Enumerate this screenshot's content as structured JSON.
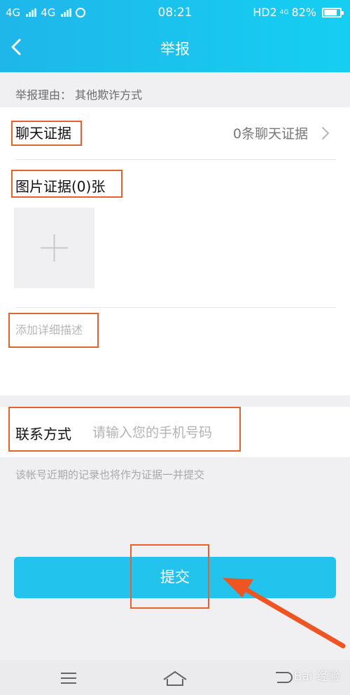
{
  "status_bar": {
    "network_left_1": "4G",
    "network_left_2": "4G",
    "time": "08:21",
    "hd_label": "HD2",
    "network_right": "4G",
    "battery_percent": "82%",
    "battery_level": 0.82
  },
  "header": {
    "title": "举报",
    "back_icon": "chevron-left-icon"
  },
  "reason": {
    "text": "举报理由：  其他欺诈方式"
  },
  "chat_evidence": {
    "label": "聊天证据",
    "value": "0条聊天证据",
    "chevron_icon": "chevron-right-icon"
  },
  "picture_evidence": {
    "label": "图片证据(0)张",
    "add_icon": "plus-icon"
  },
  "description": {
    "placeholder": "添加详细描述"
  },
  "contact": {
    "label": "联系方式",
    "placeholder": "请输入您的手机号码",
    "value": ""
  },
  "note": {
    "text": "该帐号近期的记录也将作为证据一并提交"
  },
  "submit": {
    "label": "提交"
  },
  "bottom_nav": {
    "icons": [
      "menu-icon",
      "home-icon",
      "back-icon"
    ]
  },
  "watermark": {
    "text": "Bai 经验"
  },
  "colors": {
    "accent": "#1fb6ea",
    "submit": "#22c4ee",
    "highlight": "#e4632b"
  }
}
